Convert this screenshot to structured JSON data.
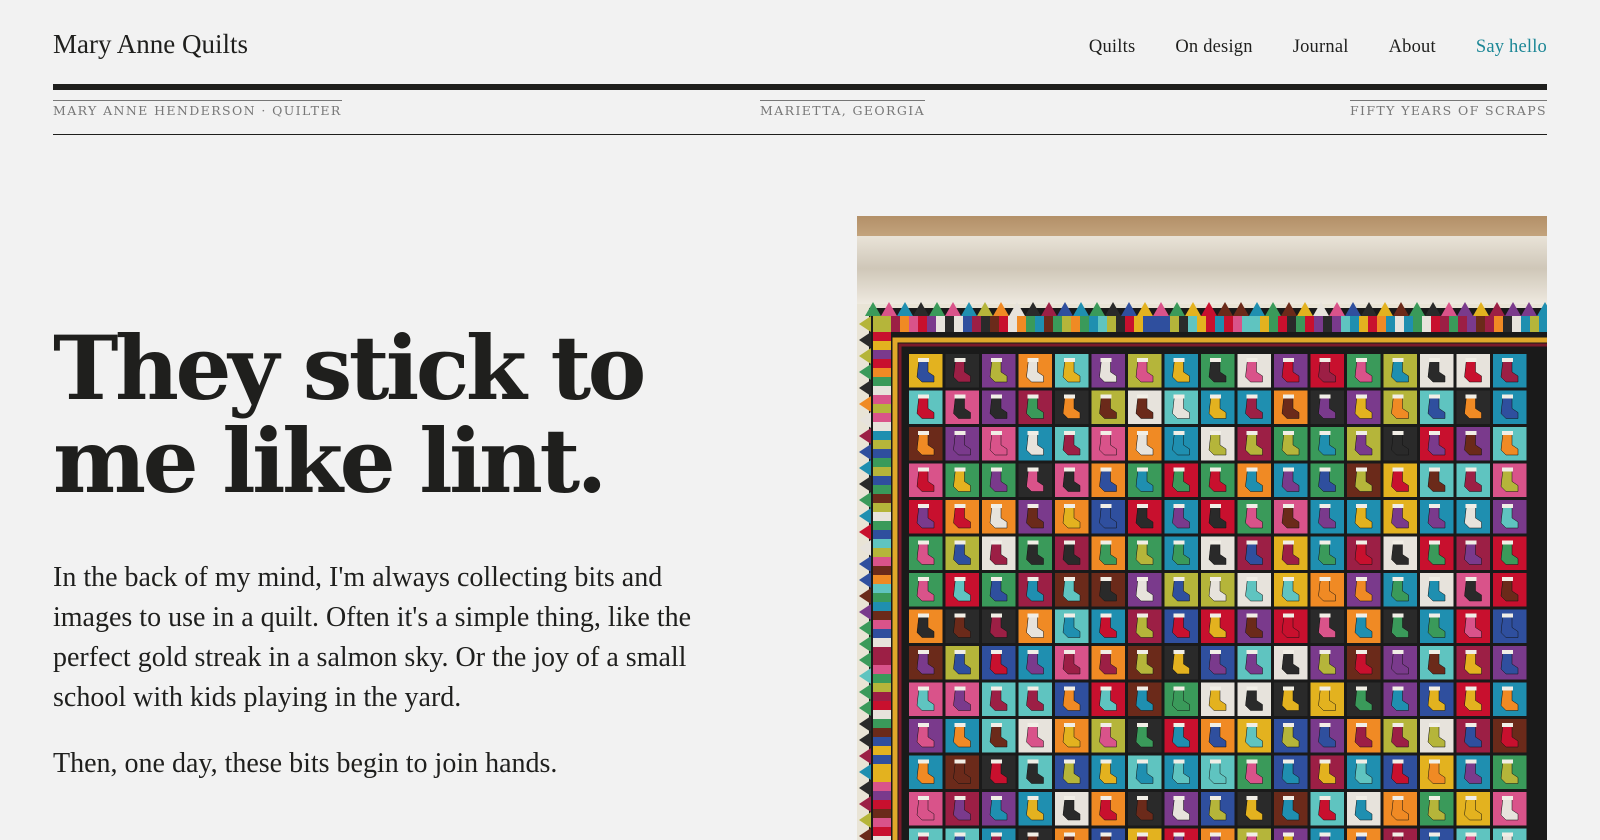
{
  "site": {
    "brand": "Mary Anne Quilts"
  },
  "nav": {
    "items": [
      {
        "label": "Quilts",
        "name": "nav-quilts"
      },
      {
        "label": "On design",
        "name": "nav-on-design"
      },
      {
        "label": "Journal",
        "name": "nav-journal"
      },
      {
        "label": "About",
        "name": "nav-about"
      },
      {
        "label": "Say hello",
        "name": "nav-say-hello",
        "accent": true
      }
    ]
  },
  "meta": {
    "left": "MARY ANNE HENDERSON · QUILTER",
    "center": "MARIETTA, GEORGIA",
    "right": "FIFTY YEARS OF SCRAPS"
  },
  "hero": {
    "headline_line1": "They stick to",
    "headline_line2": "me like lint.",
    "paragraph1": "In the back of my mind, I'm always collecting bits and images to use in a quilt. Often it's a simple thing, like the perfect gold streak in a salmon sky. Or the joy of a small school with kids playing in the yard.",
    "paragraph2": "Then, one day, these bits begin to join hands."
  },
  "colors": {
    "background": "#f2f2f2",
    "text": "#1f1f1d",
    "accent": "#1c8796",
    "muted": "#777777"
  },
  "photo": {
    "subject": "stocking-block-quilt-hanging-on-wall"
  }
}
